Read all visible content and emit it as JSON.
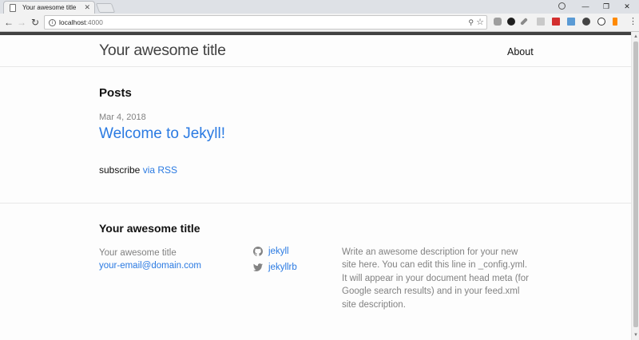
{
  "browser": {
    "tab_title": "Your awesome title",
    "url_host": "localhost",
    "url_port": ":4000"
  },
  "header": {
    "site_title": "Your awesome title",
    "nav": [
      {
        "label": "About"
      }
    ]
  },
  "posts": {
    "heading": "Posts",
    "items": [
      {
        "date": "Mar 4, 2018",
        "title": "Welcome to Jekyll!"
      }
    ],
    "subscribe_text": "subscribe",
    "subscribe_link": "via RSS"
  },
  "footer": {
    "heading": "Your awesome title",
    "name": "Your awesome title",
    "email": "your-email@domain.com",
    "social": [
      {
        "icon": "github-icon",
        "label": "jekyll"
      },
      {
        "icon": "twitter-icon",
        "label": "jekyllrb"
      }
    ],
    "description": "Write an awesome description for your new site here. You can edit this line in _config.yml. It will appear in your document head meta (for Google search results) and in your feed.xml site description."
  },
  "colors": {
    "link": "#2a7ae2",
    "muted": "#828282",
    "header_rule": "#424242"
  }
}
